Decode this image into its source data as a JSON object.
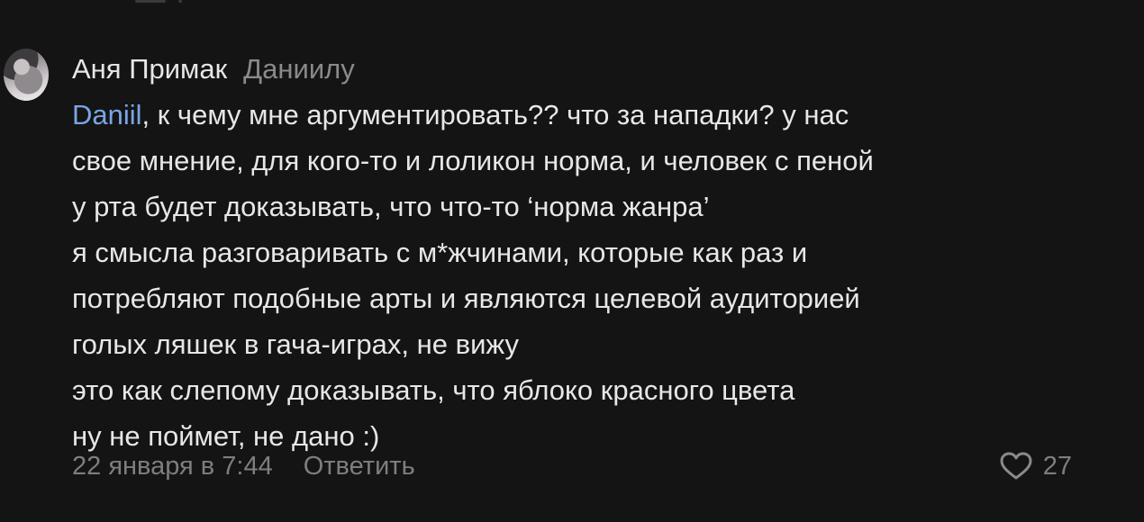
{
  "comment": {
    "author": "Аня Примак",
    "reply_to": "Даниилу",
    "mention": "Daniil",
    "lines": [
      ", к чему мне аргументировать?? что за нападки? у нас",
      "свое мнение, для кого-то и лоликон норма, и человек с пеной",
      "у рта будет доказывать, что что-то ‘норма жанра’",
      "я смысла разговаривать с м*жчинами, которые как раз и",
      "потребляют подобные арты и являются целевой аудиторией",
      "голых ляшек в гача-играх, не вижу",
      "это как слепому доказывать, что яблоко красного цвета",
      "ну не поймет, не дано :)"
    ],
    "date": "22 января в 7:44",
    "reply_label": "Ответить",
    "likes": "27"
  },
  "icons": {
    "like": "heart-outline-icon",
    "avatar": "user-avatar-photo"
  },
  "colors": {
    "background": "#141414",
    "text": "#e7e7e7",
    "muted": "#8a8a8a",
    "mention": "#7aa5e6"
  }
}
